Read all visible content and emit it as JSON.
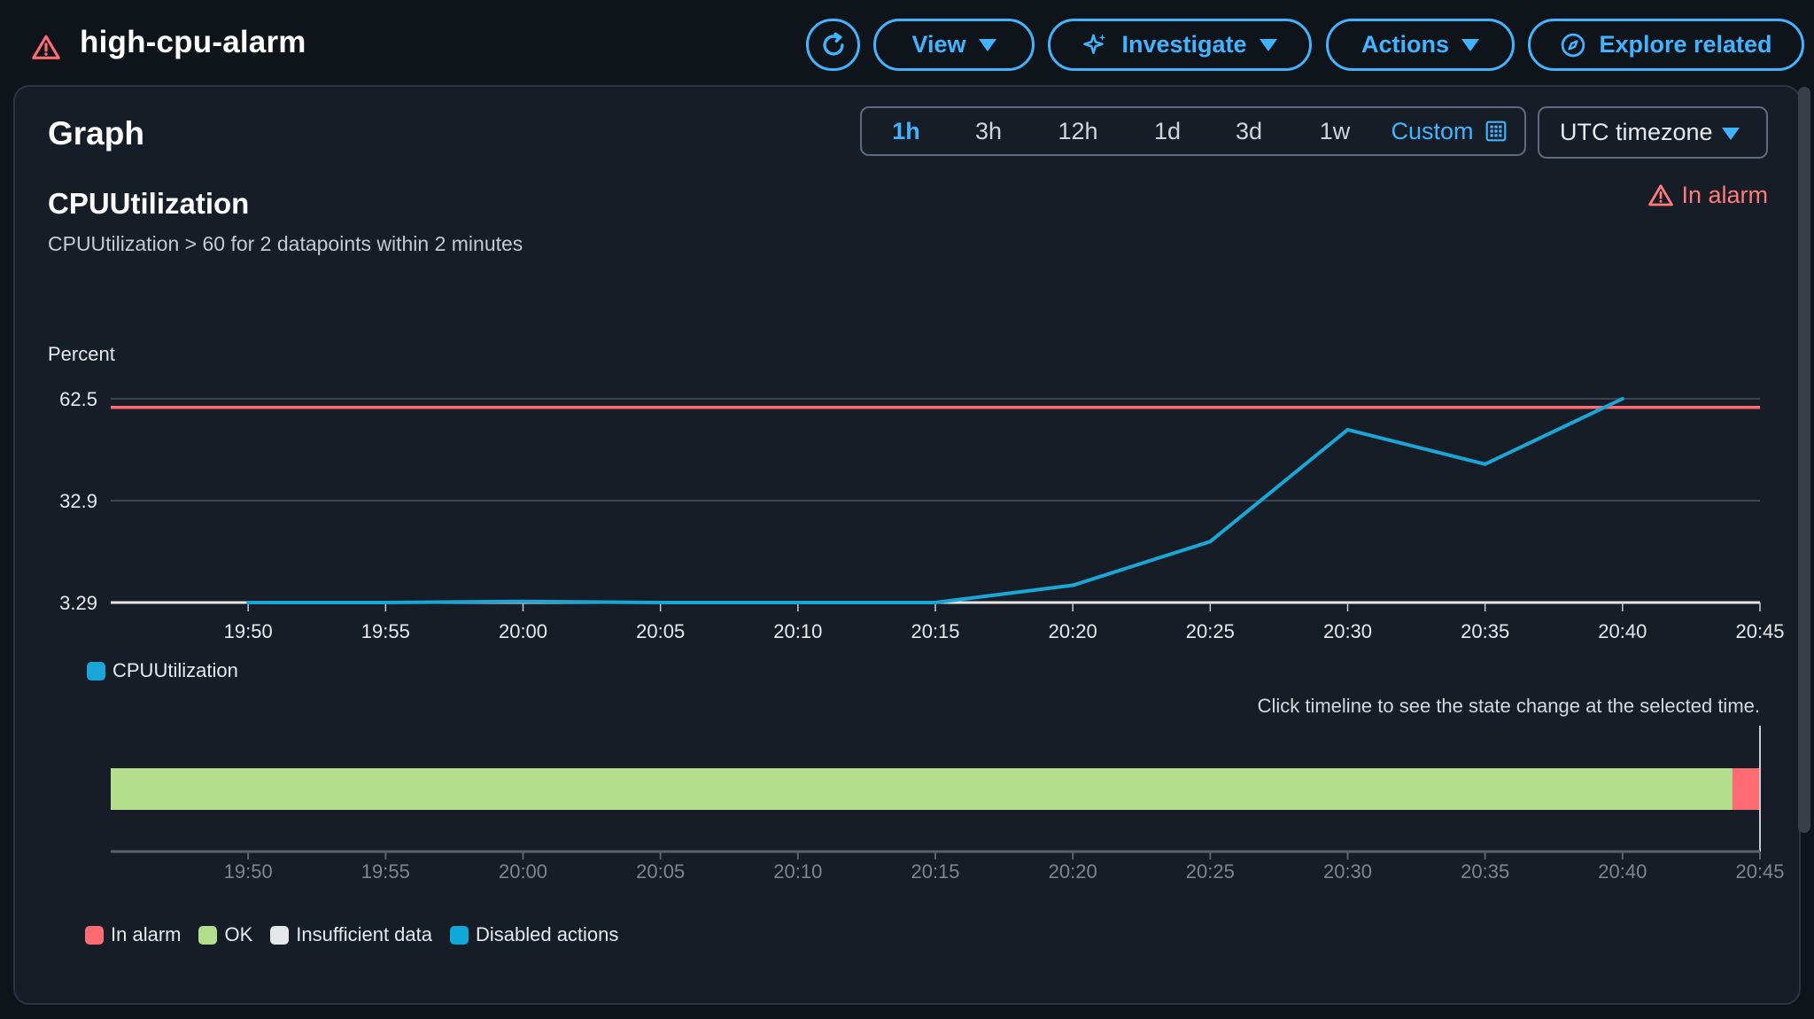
{
  "header": {
    "alarm_name": "high-cpu-alarm",
    "buttons": {
      "view": "View",
      "investigate": "Investigate",
      "actions": "Actions",
      "explore": "Explore related"
    }
  },
  "panel": {
    "title": "Graph",
    "time_ranges": [
      "1h",
      "3h",
      "12h",
      "1d",
      "3d",
      "1w",
      "Custom"
    ],
    "selected_range": "1h",
    "timezone": "UTC timezone",
    "metric_title": "CPUUtilization",
    "condition": "CPUUtilization > 60 for 2 datapoints within 2 minutes",
    "state": "In alarm",
    "timeline_hint": "Click timeline to see the state change at the selected time."
  },
  "colors": {
    "accent": "#42b4ff",
    "series": "#1aa6d6",
    "threshold": "#ff6b72",
    "ok": "#b3df8c",
    "alarm": "#ff6b72",
    "insufficient": "#e5e7eb",
    "disabled": "#10a8d8"
  },
  "chart_data": {
    "type": "line",
    "ylabel": "Percent",
    "yticks": [
      "62.5",
      "32.9",
      "3.29"
    ],
    "ylim": [
      3.29,
      62.5
    ],
    "xticks": [
      "19:50",
      "19:55",
      "20:00",
      "20:05",
      "20:10",
      "20:15",
      "20:20",
      "20:25",
      "20:30",
      "20:35",
      "20:40",
      "20:45"
    ],
    "threshold": 60,
    "series": [
      {
        "name": "CPUUtilization",
        "x": [
          "19:50",
          "19:55",
          "20:00",
          "20:05",
          "20:10",
          "20:15",
          "20:20",
          "20:25",
          "20:30",
          "20:35",
          "20:40"
        ],
        "values": [
          3.3,
          3.3,
          3.6,
          3.3,
          3.3,
          3.3,
          8.3,
          21,
          53.5,
          43.5,
          62.5
        ]
      }
    ]
  },
  "timeline": {
    "xticks": [
      "19:50",
      "19:55",
      "20:00",
      "20:05",
      "20:10",
      "20:15",
      "20:20",
      "20:25",
      "20:30",
      "20:35",
      "20:40",
      "20:45"
    ],
    "segments": [
      {
        "state": "OK",
        "from": "19:45",
        "to": "20:44"
      },
      {
        "state": "In alarm",
        "from": "20:44",
        "to": "20:45"
      }
    ],
    "legend": [
      "In alarm",
      "OK",
      "Insufficient data",
      "Disabled actions"
    ]
  }
}
